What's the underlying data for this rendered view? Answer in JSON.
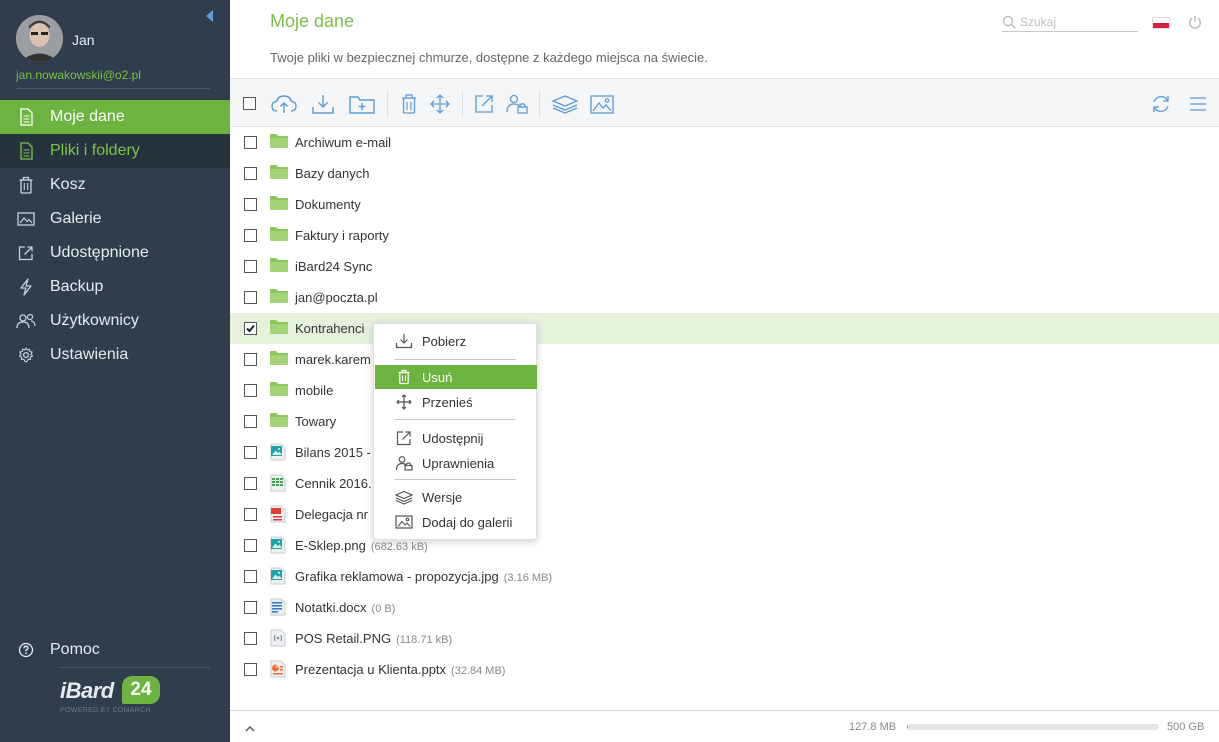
{
  "user": {
    "name": "Jan",
    "email": "jan.nowakowskii@o2.pl"
  },
  "nav": [
    {
      "label": "Moje dane",
      "icon": "file-icon",
      "state": "active"
    },
    {
      "label": "Pliki i foldery",
      "icon": "file-icon",
      "state": "sub"
    },
    {
      "label": "Kosz",
      "icon": "trash-icon",
      "state": "normal"
    },
    {
      "label": "Galerie",
      "icon": "gallery-icon",
      "state": "normal"
    },
    {
      "label": "Udostępnione",
      "icon": "share-icon",
      "state": "normal"
    },
    {
      "label": "Backup",
      "icon": "lightning-icon",
      "state": "normal"
    },
    {
      "label": "Użytkownicy",
      "icon": "users-icon",
      "state": "normal"
    },
    {
      "label": "Ustawienia",
      "icon": "gear-icon",
      "state": "normal"
    }
  ],
  "help": {
    "label": "Pomoc"
  },
  "logo": {
    "text": "iBard",
    "badge": "24",
    "powered": "POWERED BY COMARCH"
  },
  "header": {
    "title": "Moje dane",
    "subtitle": "Twoje pliki w bezpiecznej chmurze, dostępne z każdego miejsca na świecie.",
    "search_placeholder": "Szukaj"
  },
  "files": [
    {
      "name": "Archiwum e-mail",
      "size": "",
      "type": "folder",
      "checked": false
    },
    {
      "name": "Bazy danych",
      "size": "",
      "type": "folder",
      "checked": false
    },
    {
      "name": "Dokumenty",
      "size": "",
      "type": "folder",
      "checked": false
    },
    {
      "name": "Faktury i raporty",
      "size": "",
      "type": "folder",
      "checked": false
    },
    {
      "name": "iBard24 Sync",
      "size": "",
      "type": "folder",
      "checked": false
    },
    {
      "name": "jan@poczta.pl",
      "size": "",
      "type": "folder",
      "checked": false
    },
    {
      "name": "Kontrahenci",
      "size": "",
      "type": "folder",
      "checked": true
    },
    {
      "name": "marek.karem",
      "size": "",
      "type": "folder",
      "checked": false
    },
    {
      "name": "mobile",
      "size": "",
      "type": "folder",
      "checked": false
    },
    {
      "name": "Towary",
      "size": "",
      "type": "folder",
      "checked": false
    },
    {
      "name": "Bilans 2015 -",
      "size": "",
      "type": "image",
      "checked": false
    },
    {
      "name": "Cennik 2016.",
      "size": "",
      "type": "sheet",
      "checked": false
    },
    {
      "name": "Delegacja nr",
      "size": "",
      "type": "pdf",
      "checked": false
    },
    {
      "name": "E-Sklep.png",
      "size": "(682.63 kB)",
      "type": "image",
      "checked": false
    },
    {
      "name": "Grafika reklamowa - propozycja.jpg",
      "size": "(3.16 MB)",
      "type": "image",
      "checked": false
    },
    {
      "name": "Notatki.docx",
      "size": "(0 B)",
      "type": "doc",
      "checked": false
    },
    {
      "name": "POS Retail.PNG",
      "size": "(118.71 kB)",
      "type": "generic",
      "checked": false
    },
    {
      "name": "Prezentacja u Klienta.pptx",
      "size": "(32.84 MB)",
      "type": "ppt",
      "checked": false
    }
  ],
  "context_menu": {
    "items": [
      {
        "label": "Pobierz",
        "icon": "download-icon",
        "highlighted": false
      },
      {
        "label": "Usuń",
        "icon": "trash-icon",
        "highlighted": true
      },
      {
        "label": "Przenieś",
        "icon": "move-icon",
        "highlighted": false
      },
      {
        "label": "Udostępnij",
        "icon": "share-icon",
        "highlighted": false
      },
      {
        "label": "Uprawnienia",
        "icon": "permissions-icon",
        "highlighted": false
      },
      {
        "label": "Wersje",
        "icon": "layers-icon",
        "highlighted": false
      },
      {
        "label": "Dodaj do galerii",
        "icon": "add-gallery-icon",
        "highlighted": false
      }
    ]
  },
  "storage": {
    "used": "127.8 MB",
    "total": "500 GB",
    "used_fraction": 0.0003
  },
  "colors": {
    "accent": "#6db33f",
    "sidebar": "#2f3d4d",
    "selected_row": "#e6f1dc",
    "folder": "#8bc65a"
  }
}
